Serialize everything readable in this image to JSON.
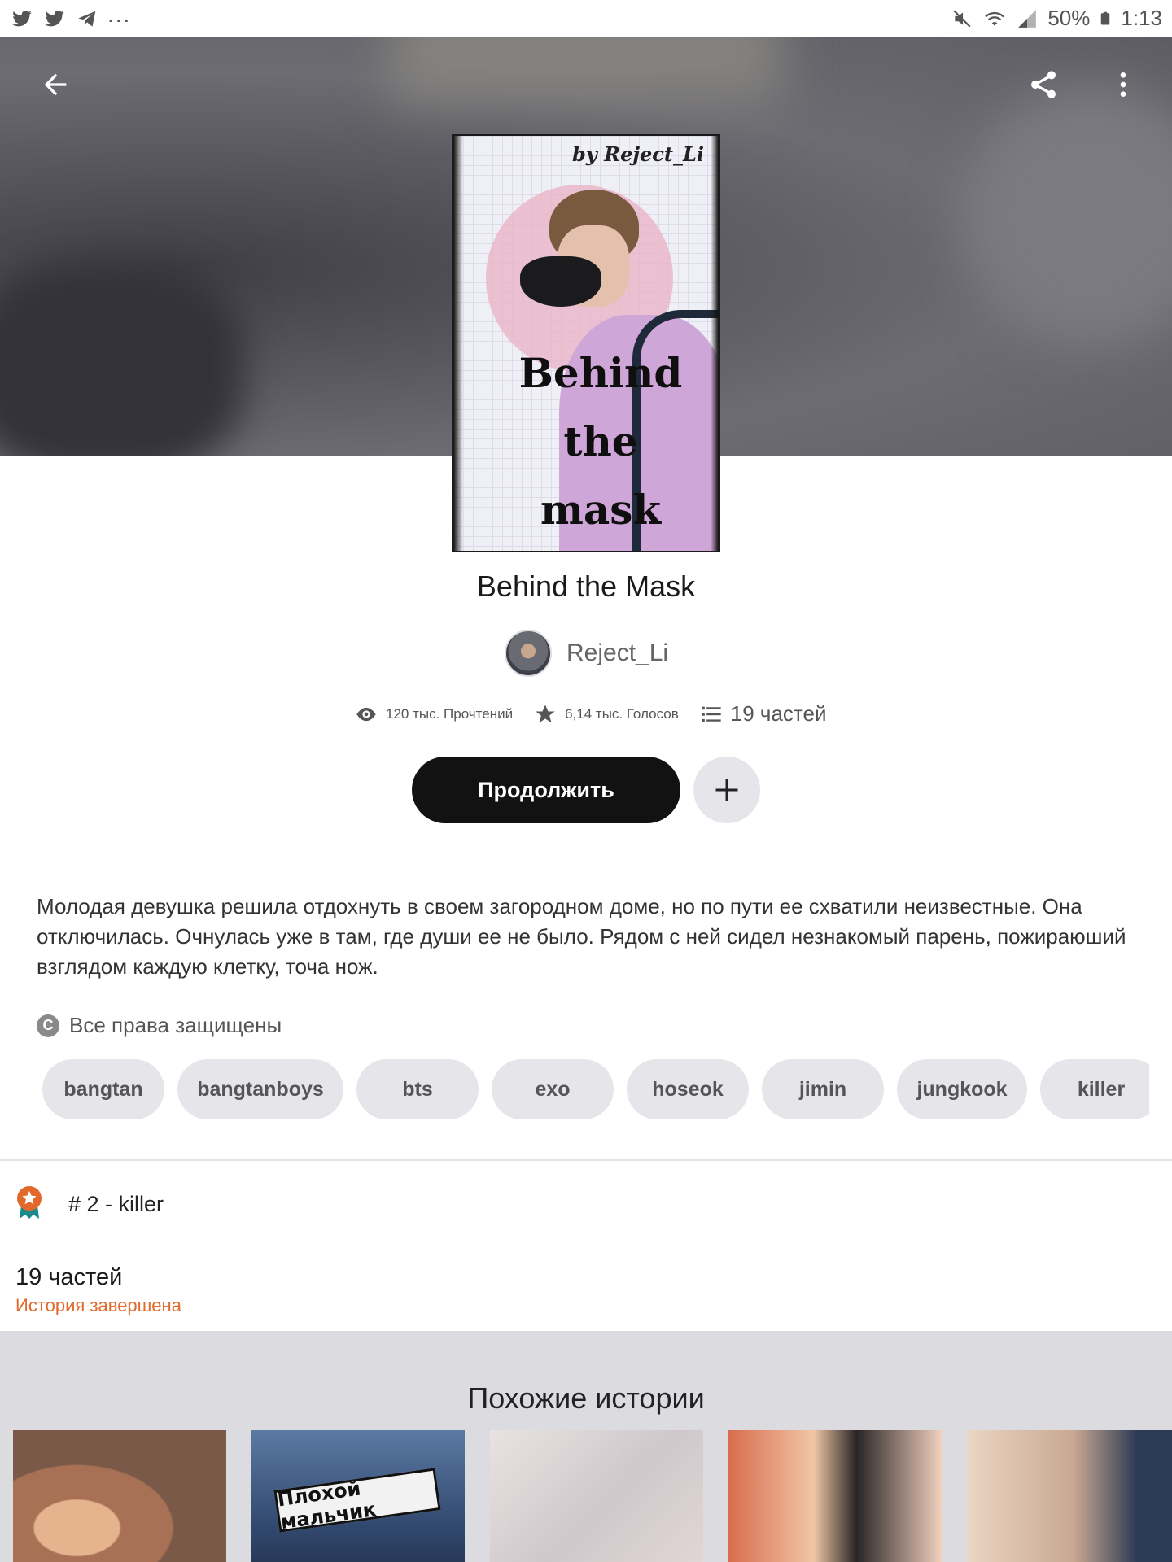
{
  "status_bar": {
    "left_icons": [
      "twitter-icon",
      "twitter-icon",
      "telegram-icon"
    ],
    "more": "...",
    "battery": "50%",
    "time": "1:13"
  },
  "story": {
    "title": "Behind the Mask",
    "author": "Reject_Li",
    "cover": {
      "byline": "by Reject_Li",
      "title_text": "Behind\nthe\nmask"
    },
    "stats": {
      "reads": "120 тыс. Прочтений",
      "votes": "6,14 тыс. Голосов",
      "parts": "19 частей"
    },
    "continue_label": "Продолжить",
    "description": "Молодая девушка решила отдохнуть в своем загородном доме, но по пути ее схватили неизвестные. Она отключилась. Очнулась уже в там, где души ее не было. Рядом с ней сидел незнакомый парень, пожираюший взглядом каждую клетку, точа нож.",
    "copyright_symbol": "C",
    "copyright": "Все права защищены",
    "tags": [
      "bangtan",
      "bangtanboys",
      "bts",
      "exo",
      "hoseok",
      "jimin",
      "jungkook",
      "killer"
    ],
    "ranking": "# 2 - killer",
    "parts_count": "19 частей",
    "status": "История завершена"
  },
  "similar": {
    "title": "Похожие истории",
    "thumb2_text": "Плохой мальчик"
  },
  "colors": {
    "accent_orange": "#e2692b",
    "button_dark": "#121212",
    "chip_bg": "#e6e5ea",
    "section_bg": "#dcdbe0"
  }
}
